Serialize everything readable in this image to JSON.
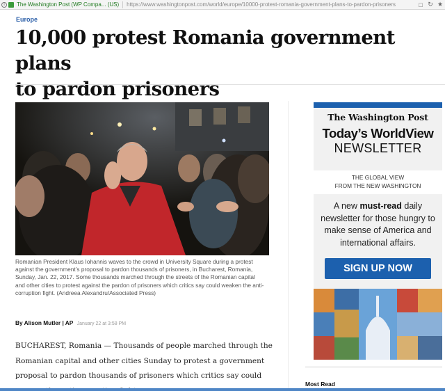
{
  "browser": {
    "site_identity": "The Washington Post (WP Compa... (US)",
    "url": "https://www.washingtonpost.com/world/europe/10000-protest-romania-government-plans-to-pardon-prisoners",
    "icons": [
      "info-icon",
      "lock-icon",
      "bookmark-icon",
      "reload-icon",
      "star-icon"
    ]
  },
  "article": {
    "section": "Europe",
    "headline_line1": "10,000 protest Romania government plans",
    "headline_line2": "to pardon prisoners",
    "caption": "Romanian President Klaus Iohannis waves to the crowd in University Square during a protest against the government’s proposal to pardon thousands of prisoners, in Bucharest, Romania, Sunday, Jan. 22, 2017. Some thousands marched through the streets of the Romanian capital and other cities to protest against the pardon of prisoners which critics say could weaken the anti-corruption fight. (Andreea Alexandru/Associated Press)",
    "byline_author": "By Alison Mutler | AP",
    "byline_time": "January 22 at 3:58 PM",
    "body": "BUCHAREST, Romania — Thousands of people marched through the Romanian capital and other cities Sunday to protest a government proposal to pardon thousands of prisoners which critics say could reverse the anti-corruption fight."
  },
  "ad": {
    "logo": "The Washington Post",
    "title": "Today’s WorldView",
    "subtitle": "NEWSLETTER",
    "global_line1": "THE GLOBAL VIEW",
    "global_line2": "FROM THE NEW WASHINGTON",
    "copy_prefix": "A new ",
    "copy_bold": "must-read",
    "copy_rest": " daily newsletter for those hungry to make sense of America and international affairs.",
    "button": "SIGN UP NOW",
    "accent": "#1c60ae"
  },
  "sidebar": {
    "most_read": "Most Read"
  }
}
